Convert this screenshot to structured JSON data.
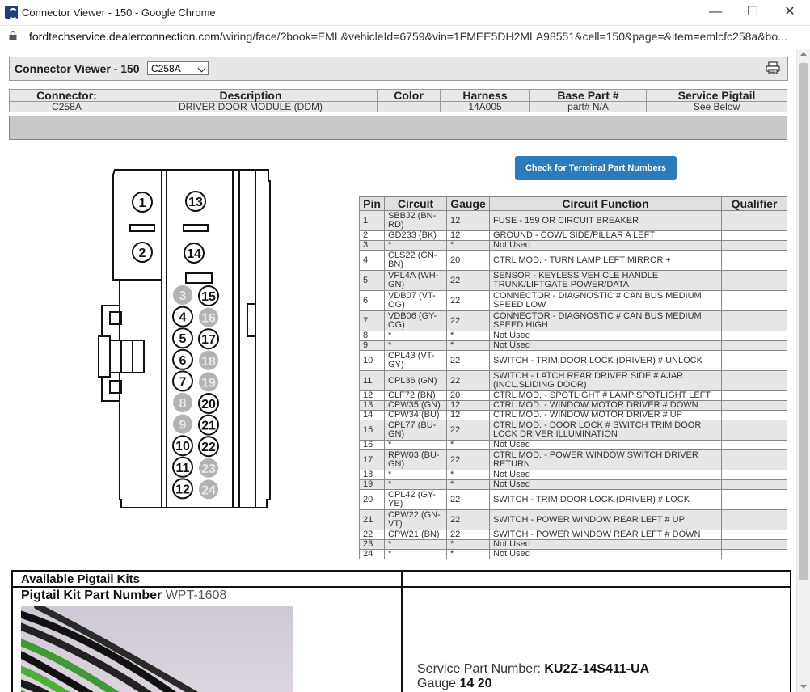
{
  "window": {
    "title": "Connector Viewer - 150 - Google Chrome",
    "url_domain": "fordtechservice.dealerconnection.com",
    "url_path": "/wiring/face/?book=EML&vehicleId=6759&vin=1FMEE5DH2MLA98551&cell=150&page=&item=emlcfc258a&bo..."
  },
  "viewer": {
    "title": "Connector Viewer - 150",
    "connector_select": "C258A"
  },
  "info": {
    "headers": [
      "Connector:",
      "Description",
      "Color",
      "Harness",
      "Base Part #",
      "Service Pigtail"
    ],
    "values": [
      "C258A",
      "DRIVER DOOR MODULE (DDM)",
      "",
      "14A005",
      "part# N/A",
      "See Below"
    ]
  },
  "check_button": "Check for Terminal Part Numbers",
  "connector_face": {
    "left_column": [
      "1",
      "2"
    ],
    "right_column": [
      "13",
      "14"
    ],
    "pairs": [
      [
        "3",
        "15"
      ],
      [
        "4",
        "16"
      ],
      [
        "5",
        "17"
      ],
      [
        "6",
        "18"
      ],
      [
        "7",
        "19"
      ],
      [
        "8",
        "20"
      ],
      [
        "9",
        "21"
      ],
      [
        "10",
        "22"
      ],
      [
        "11",
        "23"
      ],
      [
        "12",
        "24"
      ]
    ],
    "gray_pins": [
      "3",
      "16",
      "18",
      "19",
      "8",
      "9",
      "23",
      "24"
    ]
  },
  "pin_table": {
    "headers": [
      "Pin",
      "Circuit",
      "Gauge",
      "Circuit Function",
      "Qualifier"
    ],
    "rows": [
      {
        "pin": "1",
        "circuit": "SBBJ2 (BN-RD)",
        "gauge": "12",
        "function": "FUSE - 159 OR CIRCUIT BREAKER",
        "qualifier": ""
      },
      {
        "pin": "2",
        "circuit": "GD233 (BK)",
        "gauge": "12",
        "function": "GROUND - COWL SIDE/PILLAR A LEFT",
        "qualifier": ""
      },
      {
        "pin": "3",
        "circuit": "*",
        "gauge": "*",
        "function": "Not Used",
        "qualifier": ""
      },
      {
        "pin": "4",
        "circuit": "CLS22 (GN-BN)",
        "gauge": "20",
        "function": "CTRL MOD. - TURN LAMP LEFT MIRROR +",
        "qualifier": ""
      },
      {
        "pin": "5",
        "circuit": "VPL4A (WH-GN)",
        "gauge": "22",
        "function": "SENSOR - KEYLESS VEHICLE HANDLE TRUNK/LIFTGATE POWER/DATA",
        "qualifier": ""
      },
      {
        "pin": "6",
        "circuit": "VDB07 (VT-OG)",
        "gauge": "22",
        "function": "CONNECTOR - DIAGNOSTIC # CAN BUS MEDIUM SPEED LOW",
        "qualifier": ""
      },
      {
        "pin": "7",
        "circuit": "VDB06 (GY-OG)",
        "gauge": "22",
        "function": "CONNECTOR - DIAGNOSTIC # CAN BUS MEDIUM SPEED HIGH",
        "qualifier": ""
      },
      {
        "pin": "8",
        "circuit": "*",
        "gauge": "*",
        "function": "Not Used",
        "qualifier": ""
      },
      {
        "pin": "9",
        "circuit": "*",
        "gauge": "*",
        "function": "Not Used",
        "qualifier": ""
      },
      {
        "pin": "10",
        "circuit": "CPL43 (VT-GY)",
        "gauge": "22",
        "function": "SWITCH - TRIM DOOR LOCK (DRIVER) # UNLOCK",
        "qualifier": ""
      },
      {
        "pin": "11",
        "circuit": "CPL36 (GN)",
        "gauge": "22",
        "function": "SWITCH - LATCH REAR DRIVER SIDE # AJAR (INCL.SLIDING DOOR)",
        "qualifier": ""
      },
      {
        "pin": "12",
        "circuit": "CLF72 (BN)",
        "gauge": "20",
        "function": "CTRL MOD. - SPOTLIGHT # LAMP SPOTLIGHT LEFT",
        "qualifier": ""
      },
      {
        "pin": "13",
        "circuit": "CPW35 (GN)",
        "gauge": "12",
        "function": "CTRL MOD. - WINDOW MOTOR DRIVER # DOWN",
        "qualifier": ""
      },
      {
        "pin": "14",
        "circuit": "CPW34 (BU)",
        "gauge": "12",
        "function": "CTRL MOD. - WINDOW MOTOR DRIVER # UP",
        "qualifier": ""
      },
      {
        "pin": "15",
        "circuit": "CPL77 (BU-GN)",
        "gauge": "22",
        "function": "CTRL MOD. - DOOR LOCK # SWITCH TRIM DOOR LOCK DRIVER ILLUMINATION",
        "qualifier": ""
      },
      {
        "pin": "16",
        "circuit": "*",
        "gauge": "*",
        "function": "Not Used",
        "qualifier": ""
      },
      {
        "pin": "17",
        "circuit": "RPW03 (BU-GN)",
        "gauge": "22",
        "function": "CTRL MOD. - POWER WINDOW SWITCH DRIVER RETURN",
        "qualifier": ""
      },
      {
        "pin": "18",
        "circuit": "*",
        "gauge": "*",
        "function": "Not Used",
        "qualifier": ""
      },
      {
        "pin": "19",
        "circuit": "*",
        "gauge": "*",
        "function": "Not Used",
        "qualifier": ""
      },
      {
        "pin": "20",
        "circuit": "CPL42 (GY-YE)",
        "gauge": "22",
        "function": "SWITCH - TRIM DOOR LOCK (DRIVER) # LOCK",
        "qualifier": ""
      },
      {
        "pin": "21",
        "circuit": "CPW22 (GN-VT)",
        "gauge": "22",
        "function": "SWITCH - POWER WINDOW REAR LEFT # UP",
        "qualifier": ""
      },
      {
        "pin": "22",
        "circuit": "CPW21 (BN)",
        "gauge": "22",
        "function": "SWITCH - POWER WINDOW REAR LEFT # DOWN",
        "qualifier": ""
      },
      {
        "pin": "23",
        "circuit": "*",
        "gauge": "*",
        "function": "Not Used",
        "qualifier": ""
      },
      {
        "pin": "24",
        "circuit": "*",
        "gauge": "*",
        "function": "Not Used",
        "qualifier": ""
      }
    ]
  },
  "pigtail": {
    "heading": "Available Pigtail Kits",
    "kit_label": "Pigtail Kit Part Number",
    "kit_number": "WPT-1608",
    "service_label": "Service Part Number:",
    "service_number": "KU2Z-14S411-UA",
    "gauge_label": "Gauge:",
    "gauge_value": "14 20"
  },
  "colors": {
    "button_blue": "#2c7bbd",
    "header_gray": "#e7e7e7",
    "pin_gray": "#b3b3b3"
  }
}
